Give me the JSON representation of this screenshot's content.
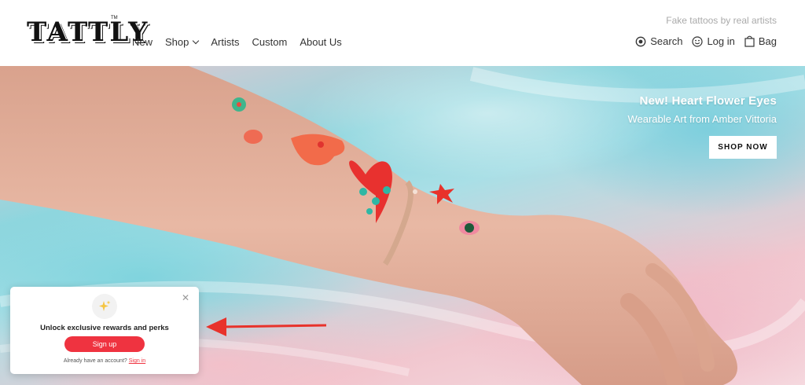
{
  "header": {
    "logo": "TATTLY",
    "tagline": "Fake tattoos by real artists",
    "nav": [
      {
        "label": "New"
      },
      {
        "label": "Shop"
      },
      {
        "label": "Artists"
      },
      {
        "label": "Custom"
      },
      {
        "label": "About Us"
      }
    ],
    "utility": {
      "search": "Search",
      "login": "Log in",
      "bag": "Bag"
    }
  },
  "hero": {
    "title": "New! Heart Flower Eyes",
    "subtitle": "Wearable Art from Amber Vittoria",
    "cta": "SHOP NOW"
  },
  "popup": {
    "icon": "sparkles-icon",
    "title": "Unlock exclusive rewards and perks",
    "signup": "Sign up",
    "footer_text": "Already have an account?",
    "signin": "Sign in"
  },
  "colors": {
    "accent_red": "#ef3340",
    "annotation_arrow": "#e8322b"
  }
}
